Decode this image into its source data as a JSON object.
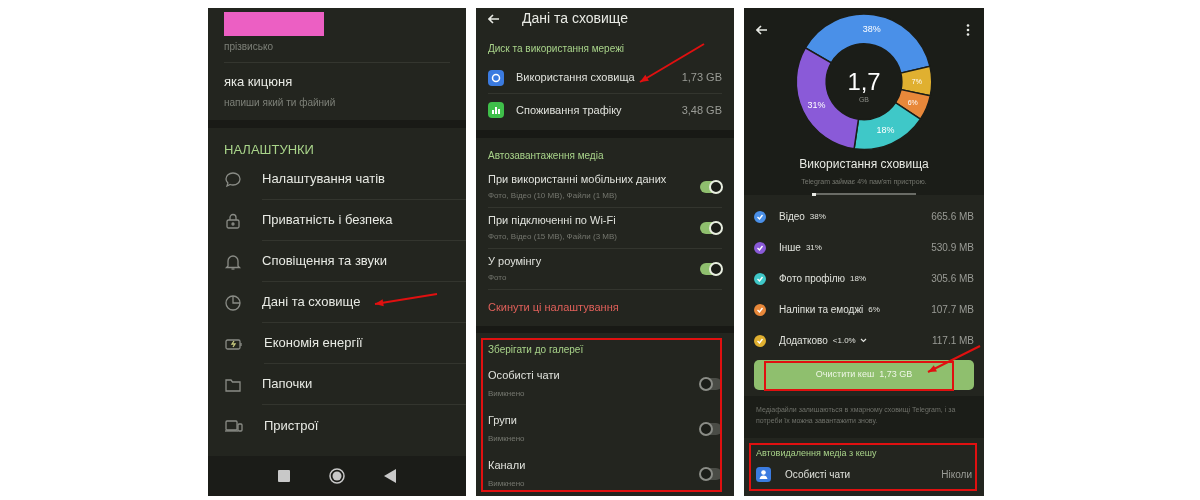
{
  "profile": {
    "nickname_label": "прізвисько",
    "bio": "яка кицюня",
    "bio_hint": "напиши який ти файний"
  },
  "settings": {
    "header": "НАЛАШТУНКИ",
    "items": [
      {
        "label": "Налаштування чатів"
      },
      {
        "label": "Приватність і безпека"
      },
      {
        "label": "Сповіщення та звуки"
      },
      {
        "label": "Дані та сховище"
      },
      {
        "label": "Економія енергії"
      },
      {
        "label": "Папочки"
      },
      {
        "label": "Пристрої"
      }
    ]
  },
  "data_screen": {
    "title": "Дані та сховище",
    "disk": {
      "header": "Диск та використання мережі",
      "rows": [
        {
          "label": "Використання сховища",
          "value": "1,73 GB",
          "color": "#3b7be0"
        },
        {
          "label": "Споживання трафіку",
          "value": "3,48 GB",
          "color": "#3fbf4a"
        }
      ]
    },
    "autodownload": {
      "header": "Автозавантаження медіа",
      "rows": [
        {
          "label": "При використанні мобільних даних",
          "hint": "Фото, Відео (10 MB), Файли (1 MB)",
          "on": true
        },
        {
          "label": "При підключенні по Wi-Fi",
          "hint": "Фото, Відео (15 MB), Файли (3 MB)",
          "on": true
        },
        {
          "label": "У роумінгу",
          "hint": "Фото",
          "on": true
        }
      ],
      "reset": "Скинути ці налаштування"
    },
    "gallery": {
      "header": "Зберігати до галереї",
      "rows": [
        {
          "label": "Особисті чати",
          "hint": "Вимкнено",
          "on": false
        },
        {
          "label": "Групи",
          "hint": "Вимкнено",
          "on": false
        },
        {
          "label": "Канали",
          "hint": "Вимкнено",
          "on": false
        }
      ]
    }
  },
  "storage_screen": {
    "total": "1,7",
    "unit": "GB",
    "chart_data": {
      "type": "donut",
      "values": [
        38,
        7,
        6,
        18,
        31
      ],
      "value_labels": [
        "38%",
        "7%",
        "6%",
        "18%",
        "31%"
      ]
    },
    "title": "Використання сховища",
    "subtitle": "Telegram займає 4% пам'яті пристрою.",
    "level": 0.04,
    "items": [
      {
        "label": "Відео",
        "percent": "38%",
        "size": "665.6 MB",
        "color": "#4a90e8",
        "checked": true
      },
      {
        "label": "Інше",
        "percent": "31%",
        "size": "530.9 MB",
        "color": "#8a5ad8",
        "checked": true
      },
      {
        "label": "Фото профілю",
        "percent": "18%",
        "size": "305.6 MB",
        "color": "#3fc8c8",
        "checked": true
      },
      {
        "label": "Наліпки та емоджі",
        "percent": "6%",
        "size": "107.7 MB",
        "color": "#e8883a",
        "checked": true
      },
      {
        "label": "Додатково",
        "percent": "<1.0%",
        "size": "117.1 MB",
        "color": "#e0b030",
        "checked": true,
        "expandable": true
      }
    ],
    "clear_button": "Очистити кеш  1,73 GB",
    "note": "Медіафайли залишаються в хмарному сховищі Telegram, і за потреби їх можна завантажити знову.",
    "auto_delete": {
      "header": "Автовидалення медіа з кешу",
      "rows": [
        {
          "label": "Особисті чати",
          "value": "Ніколи"
        }
      ]
    }
  }
}
